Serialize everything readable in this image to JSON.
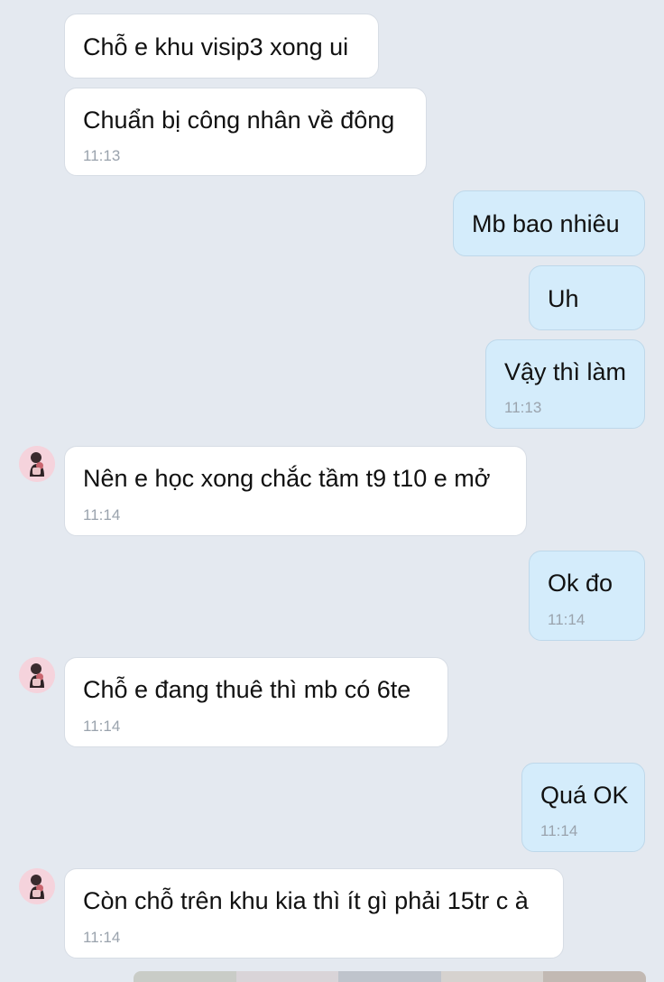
{
  "messages": [
    {
      "dir": "in",
      "text": "Chỗ e khu visip3 xong ui",
      "time": ""
    },
    {
      "dir": "in",
      "text": "Chuẩn bị công nhân về đông",
      "time": "11:13"
    },
    {
      "dir": "out",
      "text": "Mb bao nhiêu",
      "time": ""
    },
    {
      "dir": "out",
      "text": "Uh",
      "time": ""
    },
    {
      "dir": "out",
      "text": "Vậy thì làm",
      "time": "11:13"
    },
    {
      "dir": "in",
      "text": "Nên e học xong chắc tầm t9 t10 e mở",
      "time": "11:14"
    },
    {
      "dir": "out",
      "text": "Ok đo",
      "time": "11:14"
    },
    {
      "dir": "in",
      "text": "Chỗ e đang thuê thì mb có 6te",
      "time": "11:14"
    },
    {
      "dir": "out",
      "text": "Quá OK",
      "time": "11:14"
    },
    {
      "dir": "in",
      "text": "Còn chỗ trên khu kia thì ít gì phải 15tr c à",
      "time": "11:14"
    }
  ],
  "colors": {
    "background": "#e4e9f0",
    "incoming_bubble": "#ffffff",
    "outgoing_bubble": "#d4ecfb",
    "timestamp": "#9aa3ad"
  },
  "icons": {
    "avatar": "contact-avatar-icon"
  }
}
